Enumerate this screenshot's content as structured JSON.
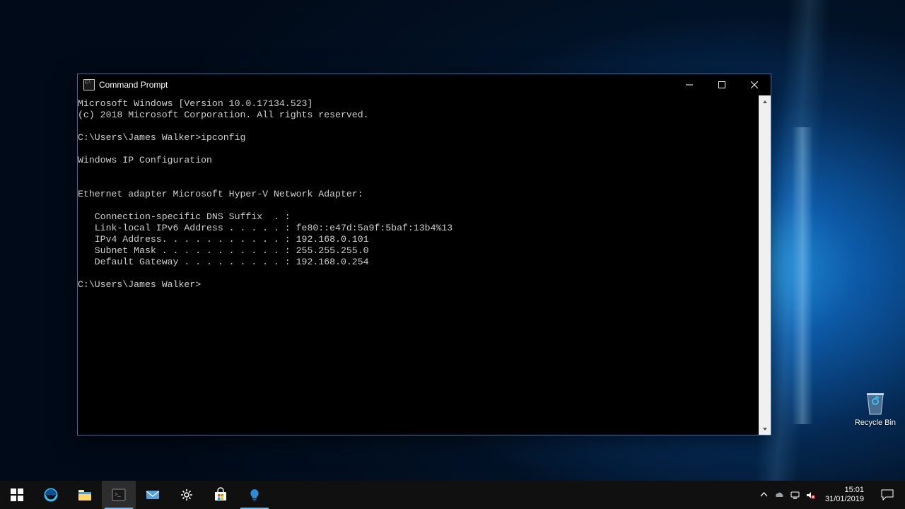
{
  "window": {
    "title": "Command Prompt"
  },
  "terminal": {
    "lines": [
      "Microsoft Windows [Version 10.0.17134.523]",
      "(c) 2018 Microsoft Corporation. All rights reserved.",
      "",
      "C:\\Users\\James Walker>ipconfig",
      "",
      "Windows IP Configuration",
      "",
      "",
      "Ethernet adapter Microsoft Hyper-V Network Adapter:",
      "",
      "   Connection-specific DNS Suffix  . :",
      "   Link-local IPv6 Address . . . . . : fe80::e47d:5a9f:5baf:13b4%13",
      "   IPv4 Address. . . . . . . . . . . : 192.168.0.101",
      "   Subnet Mask . . . . . . . . . . . : 255.255.255.0",
      "   Default Gateway . . . . . . . . . : 192.168.0.254",
      "",
      "C:\\Users\\James Walker>"
    ]
  },
  "desktop": {
    "recycle_bin_label": "Recycle Bin"
  },
  "taskbar": {
    "start": "Start",
    "edge": "Microsoft Edge",
    "explorer": "File Explorer",
    "cmd": "Command Prompt",
    "mail": "Mail",
    "settings": "Settings",
    "store": "Microsoft Store",
    "tips": "Tips"
  },
  "tray": {
    "time": "15:01",
    "date": "31/01/2019"
  }
}
